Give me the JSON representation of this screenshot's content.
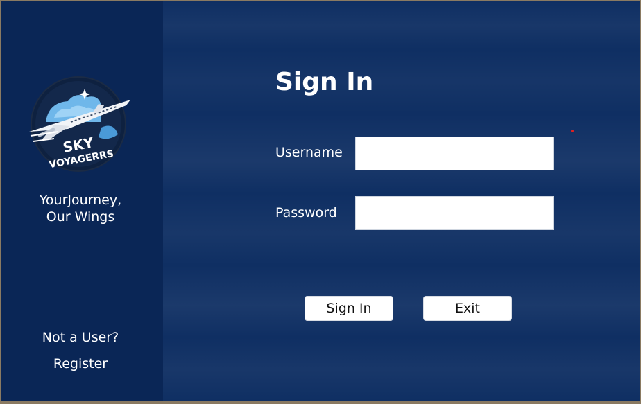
{
  "logo": {
    "line1": "SKY",
    "line2": "VOYAGERRS",
    "icon": "airplane-logo-icon"
  },
  "sidebar": {
    "tagline_line1": "YourJourney,",
    "tagline_line2": "Our Wings",
    "not_user_text": "Not a User?",
    "register_link": "Register"
  },
  "form": {
    "title": "Sign In",
    "username_label": "Username",
    "username_value": "",
    "password_label": "Password",
    "password_value": "",
    "signin_button": "Sign In",
    "exit_button": "Exit"
  },
  "colors": {
    "sidebar_bg": "#0a2656",
    "main_bg": "#0f2f63",
    "text": "#ffffff",
    "accent_red": "#e02020"
  }
}
